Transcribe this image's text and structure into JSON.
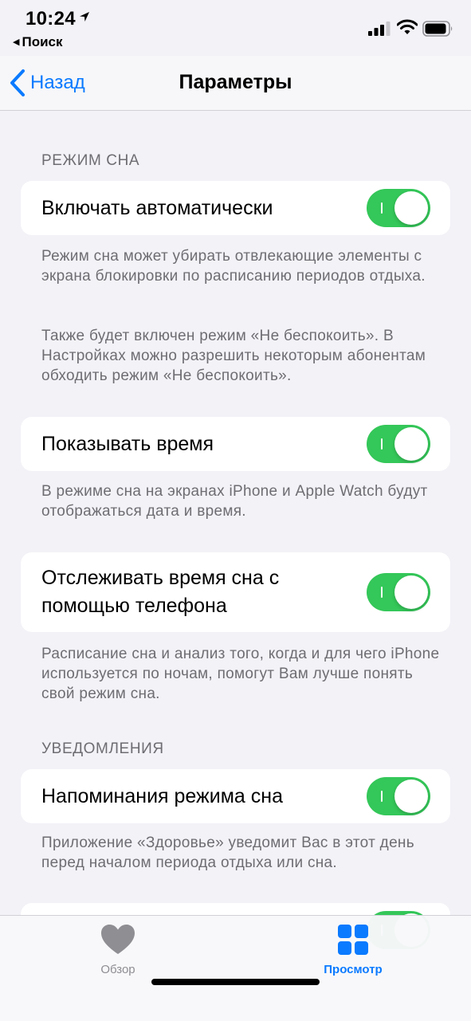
{
  "status_bar": {
    "time": "10:24",
    "back_app": "Поиск"
  },
  "nav": {
    "back_label": "Назад",
    "title": "Параметры"
  },
  "sections": {
    "sleep_mode": {
      "header": "РЕЖИМ СНА",
      "rows": [
        {
          "label": "Включать автоматически",
          "toggle_on": true,
          "footnote_1": "Режим сна может убирать отвлекающие элементы с экрана блокировки по расписанию периодов отдыха.",
          "footnote_2": "Также будет включен режим «Не беспокоить». В Настройках можно разрешить некоторым абонентам обходить режим «Не беспокоить»."
        },
        {
          "label": "Показывать время",
          "toggle_on": true,
          "footnote_1": "В режиме сна на экранах iPhone и Apple Watch будут отображаться дата и время."
        },
        {
          "label": "Отслеживать время сна с помощью телефона",
          "toggle_on": true,
          "footnote_1": "Расписание сна и анализ того, когда и для чего iPhone используется по ночам, помогут Вам лучше понять свой режим сна."
        }
      ]
    },
    "notifications": {
      "header": "УВЕДОМЛЕНИЯ",
      "rows": [
        {
          "label": "Напоминания режима сна",
          "toggle_on": true,
          "footnote_1": "Приложение «Здоровье» уведомит Вас в этот день перед началом периода отдыха или сна."
        },
        {
          "label": "",
          "toggle_on": true
        }
      ]
    }
  },
  "tab_bar": {
    "tabs": [
      {
        "label": "Обзор",
        "icon": "heart-icon",
        "selected": false
      },
      {
        "label": "Просмотр",
        "icon": "grid-icon",
        "selected": true
      }
    ]
  },
  "colors": {
    "accent": "#0A7AFF",
    "toggle_on": "#34C759",
    "background": "#F2F2F7",
    "secondary_text": "#6D6D72",
    "tab_inactive": "#8E8E93"
  }
}
